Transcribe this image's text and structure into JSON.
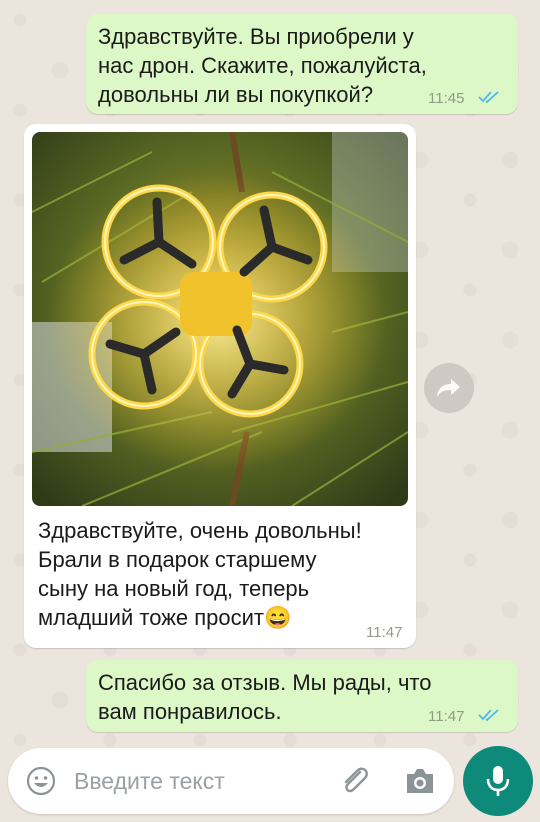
{
  "messages": [
    {
      "direction": "outgoing",
      "lines": [
        "Здравствуйте. Вы приобрели у",
        "нас дрон. Скажите, пожалуйста,",
        "довольны ли вы покупкой?"
      ],
      "time": "11:45",
      "read": true
    },
    {
      "direction": "incoming",
      "has_photo": true,
      "photo_subject": "drone-with-glowing-rings-in-pine-tree",
      "lines": [
        "Здравствуйте, очень довольны!",
        "Брали в подарок старшему",
        "сыну на новый год, теперь",
        "младший тоже просит"
      ],
      "emoji": "😄",
      "time": "11:47"
    },
    {
      "direction": "outgoing",
      "lines": [
        "Спасибо за отзыв. Мы рады, что",
        "вам понравилось."
      ],
      "time": "11:47",
      "read": true
    }
  ],
  "composer": {
    "placeholder": "Введите текст",
    "emoji_icon": "emoji-icon",
    "attach_icon": "paperclip-icon",
    "camera_icon": "camera-icon",
    "mic_icon": "microphone-icon"
  },
  "colors": {
    "outgoing_bubble": "#dcf8c6",
    "incoming_bubble": "#ffffff",
    "read_ticks": "#4fb6ec",
    "mic_button": "#0e8a7a",
    "chat_background": "#ece5dd"
  }
}
